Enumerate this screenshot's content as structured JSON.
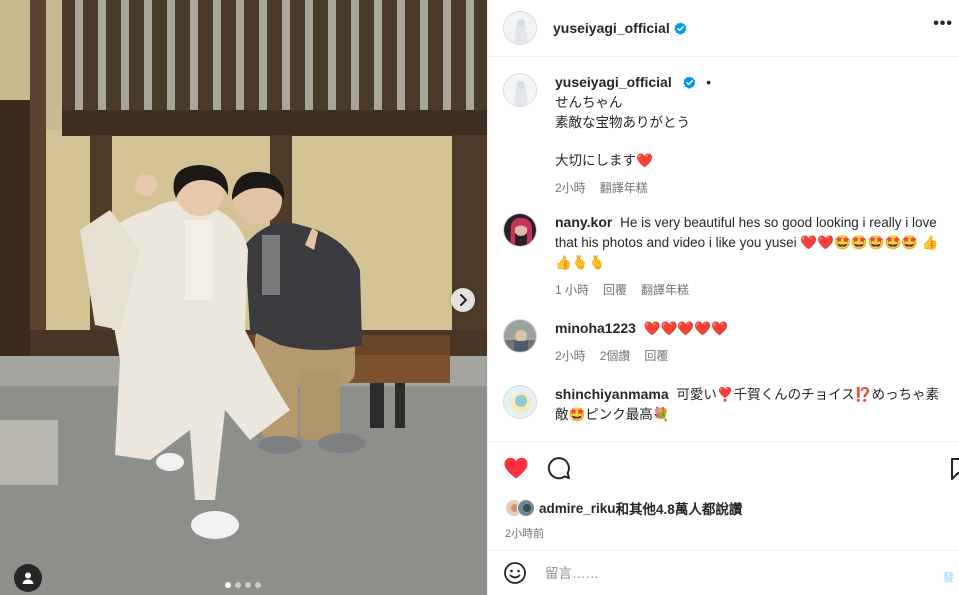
{
  "post": {
    "username": "yuseiyagi_official",
    "caption_lines": [
      "せんちゃん",
      "素敵な宝物ありがとう",
      "",
      "大切にします❤️"
    ],
    "caption_time": "2小時",
    "caption_translate": "翻譯年糕",
    "dot_sep": "•"
  },
  "comments": [
    {
      "username": "nany.kor",
      "text": "He is very beautiful hes so good looking i really i love that his photos and video i like you yusei ❤️❤️🤩🤩🤩🤩🤩 👍👍🫰🫰",
      "time": "1 小時",
      "reply": "回覆",
      "translate": "翻譯年糕",
      "likes": ""
    },
    {
      "username": "minoha1223",
      "text": "❤️❤️❤️❤️❤️",
      "time": "2小時",
      "likes": "2個讚",
      "reply": "回覆",
      "translate": ""
    },
    {
      "username": "shinchiyanmama",
      "text": "可愛い❣️千賀くんのチョイス⁉️めっちゃ素敵🤩ピンク最高💐",
      "time": "",
      "reply": "",
      "translate": "",
      "likes": ""
    }
  ],
  "liked_by": {
    "user": "admire_riku",
    "rest": "和其他4.8萬人都說讚"
  },
  "posted_time": "2小時前",
  "compose": {
    "placeholder": "留言……",
    "post_label": "發"
  },
  "icons": {
    "like": "heart-filled-icon",
    "comment": "comment-icon",
    "save": "bookmark-icon",
    "emoji": "emoji-icon",
    "more": "more-icon",
    "next": "chevron-right-icon",
    "tag": "user-tag-icon"
  },
  "carousel": {
    "total": 4,
    "current": 1
  },
  "colors": {
    "heart": "#ff3040",
    "verified": "#0095f6",
    "muted": "#737373"
  }
}
